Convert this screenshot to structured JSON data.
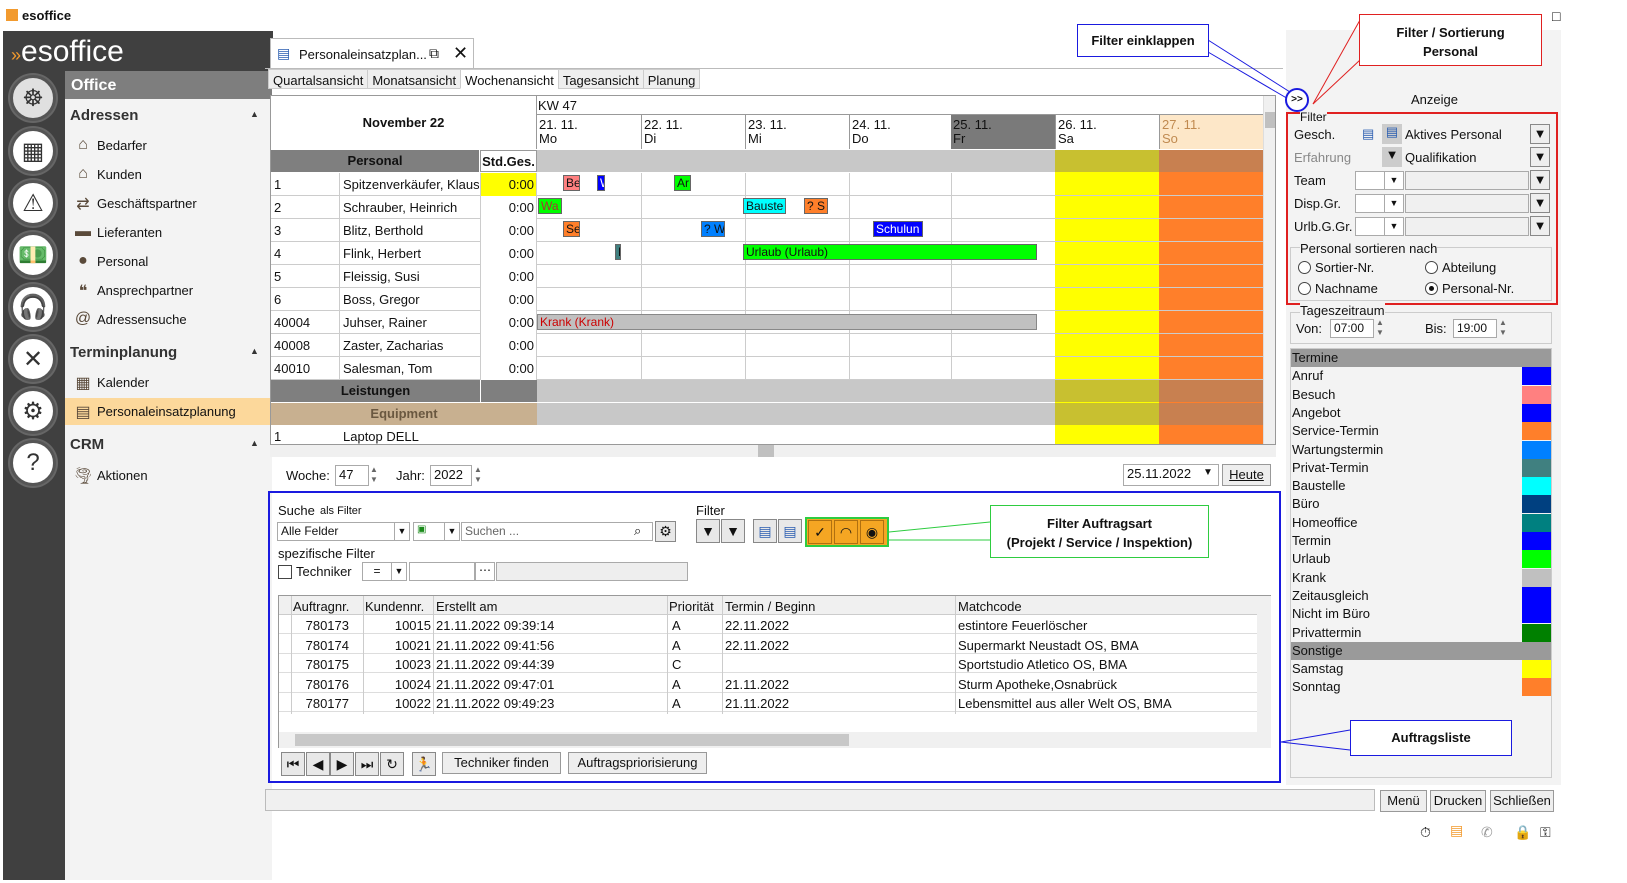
{
  "app": {
    "title": "esoffice",
    "brand": "esoffice"
  },
  "nav": {
    "office": "Office",
    "sections": {
      "adressen": "Adressen",
      "terminplanung": "Terminplanung",
      "crm": "CRM"
    },
    "items": {
      "bedarfer": "Bedarfer",
      "kunden": "Kunden",
      "geschaeftspartner": "Geschäftspartner",
      "lieferanten": "Lieferanten",
      "personal": "Personal",
      "ansprechpartner": "Ansprechpartner",
      "adressensuche": "Adressensuche",
      "kalender": "Kalender",
      "personaleinsatzplanung": "Personaleinsatzplanung",
      "aktionen": "Aktionen"
    }
  },
  "doc_tab": {
    "label": "Personaleinsatzplan..."
  },
  "view_tabs": [
    "Quartalsansicht",
    "Monatsansicht",
    "Wochenansicht",
    "Tagesansicht",
    "Planung"
  ],
  "grid": {
    "month": "November 22",
    "kw": "KW 47",
    "personal_header": "Personal",
    "std_header": "Std.Ges.",
    "days": [
      {
        "date": "21. 11.",
        "wd": "Mo"
      },
      {
        "date": "22. 11.",
        "wd": "Di"
      },
      {
        "date": "23. 11.",
        "wd": "Mi"
      },
      {
        "date": "24. 11.",
        "wd": "Do"
      },
      {
        "date": "25. 11.",
        "wd": "Fr"
      },
      {
        "date": "26. 11.",
        "wd": "Sa"
      },
      {
        "date": "27. 11.",
        "wd": "So"
      }
    ],
    "rows": [
      {
        "nr": "1",
        "name": "Spitzenverkäufer, Klaus",
        "std": "0:00"
      },
      {
        "nr": "2",
        "name": "Schrauber, Heinrich",
        "std": "0:00"
      },
      {
        "nr": "3",
        "name": "Blitz, Berthold",
        "std": "0:00"
      },
      {
        "nr": "4",
        "name": "Flink, Herbert",
        "std": "0:00"
      },
      {
        "nr": "5",
        "name": "Fleissig, Susi",
        "std": "0:00"
      },
      {
        "nr": "6",
        "name": "Boss, Gregor",
        "std": "0:00"
      },
      {
        "nr": "40004",
        "name": "Juhser, Rainer",
        "std": "0:00"
      },
      {
        "nr": "40008",
        "name": "Zaster, Zacharias",
        "std": "0:00"
      },
      {
        "nr": "40010",
        "name": "Salesman, Tom",
        "std": "0:00"
      }
    ],
    "leistungen": "Leistungen",
    "equipment": "Equipment",
    "equip_row": {
      "nr": "1",
      "name": "Laptop DELL"
    },
    "events": {
      "e1": "Be",
      "e2": "W",
      "e3": "Ar",
      "e4": "Wa",
      "e5": "Bauste",
      "e6": "? S",
      "e7": "Se",
      "e8": "? W",
      "e9": "Schulun",
      "e10": "F",
      "e11": "Urlaub (Urlaub)",
      "e12": "Krank (Krank)"
    },
    "colors": {
      "sa": "#ffff00",
      "so": "#ff7f2a",
      "fr": "#7a7a7a"
    }
  },
  "week_nav": {
    "woche_label": "Woche:",
    "woche": "47",
    "jahr_label": "Jahr:",
    "jahr": "2022",
    "date": "25.11.2022",
    "heute": "Heute"
  },
  "search": {
    "label": "Suche",
    "as_filter": "als Filter",
    "field": "Alle Felder",
    "placeholder": "Suchen ...",
    "specific": "spezifische Filter",
    "techniker": "Techniker",
    "op": "=",
    "filter_label": "Filter"
  },
  "orders": {
    "columns": [
      "Auftragnr.",
      "Kundennr.",
      "Erstellt am",
      "Priorität",
      "Termin / Beginn",
      "Matchcode"
    ],
    "rows": [
      [
        "780173",
        "10015",
        "21.11.2022 09:39:14",
        "A",
        "22.11.2022",
        "estintore Feuerlöscher"
      ],
      [
        "780174",
        "10021",
        "21.11.2022 09:41:56",
        "A",
        "22.11.2022",
        "Supermarkt Neustadt OS, BMA"
      ],
      [
        "780175",
        "10023",
        "21.11.2022 09:44:39",
        "C",
        "",
        "Sportstudio Atletico OS, BMA"
      ],
      [
        "780176",
        "10024",
        "21.11.2022 09:47:01",
        "A",
        "21.11.2022",
        "Sturm Apotheke,Osnabrück"
      ],
      [
        "780177",
        "10022",
        "21.11.2022 09:49:23",
        "A",
        "21.11.2022",
        "Lebensmittel aus aller Welt OS, BMA"
      ]
    ],
    "btn_techniker": "Techniker finden",
    "btn_prio": "Auftragspriorisierung"
  },
  "right": {
    "anzeige": "Anzeige",
    "filter": "Filter",
    "gesch": "Gesch.",
    "aktives": "Aktives Personal",
    "erfahrung": "Erfahrung",
    "qualifikation": "Qualifikation",
    "team": "Team",
    "dispgr": "Disp.Gr.",
    "urlbggr": "Urlb.G.Gr.",
    "sort_title": "Personal sortieren nach",
    "sort": [
      "Sortier-Nr.",
      "Abteilung",
      "Nachname",
      "Personal-Nr."
    ],
    "tageszeitraum": "Tageszeitraum",
    "von_label": "Von:",
    "von": "07:00",
    "bis_label": "Bis:",
    "bis": "19:00",
    "legend": [
      {
        "label": "Termine",
        "header": true,
        "color": ""
      },
      {
        "label": "Anruf",
        "color": "#0000ff"
      },
      {
        "label": "Besuch",
        "color": "#ff8080"
      },
      {
        "label": "Angebot",
        "color": "#0000ff"
      },
      {
        "label": "Service-Termin",
        "color": "#ff7f2a"
      },
      {
        "label": "Wartungstermin",
        "color": "#0080ff"
      },
      {
        "label": "Privat-Termin",
        "color": "#408080"
      },
      {
        "label": "Baustelle",
        "color": "#00ffff"
      },
      {
        "label": "Büro",
        "color": "#004080"
      },
      {
        "label": "Homeoffice",
        "color": "#008080"
      },
      {
        "label": "Termin",
        "color": "#0000ff"
      },
      {
        "label": "Urlaub",
        "color": "#00ff00"
      },
      {
        "label": "Krank",
        "color": "#c0c0c0"
      },
      {
        "label": "Zeitausgleich",
        "color": "#0000ff"
      },
      {
        "label": "Nicht im Büro",
        "color": "#0000ff"
      },
      {
        "label": "Privattermin",
        "color": "#008000"
      },
      {
        "label": "Sonstige",
        "header": true,
        "color": ""
      },
      {
        "label": "Samstag",
        "color": "#ffff00"
      },
      {
        "label": "Sonntag",
        "color": "#ff7f2a"
      }
    ],
    "menu": "Menü",
    "drucken": "Drucken",
    "schliessen": "Schließen"
  },
  "callouts": {
    "filter_einklappen": "Filter einklappen",
    "filter_sort_1": "Filter / Sortierung",
    "filter_sort_2": "Personal",
    "auftragsart_1": "Filter Auftragsart",
    "auftragsart_2": "(Projekt / Service / Inspektion)",
    "auftragsliste": "Auftragsliste",
    "collapse": ">>"
  }
}
